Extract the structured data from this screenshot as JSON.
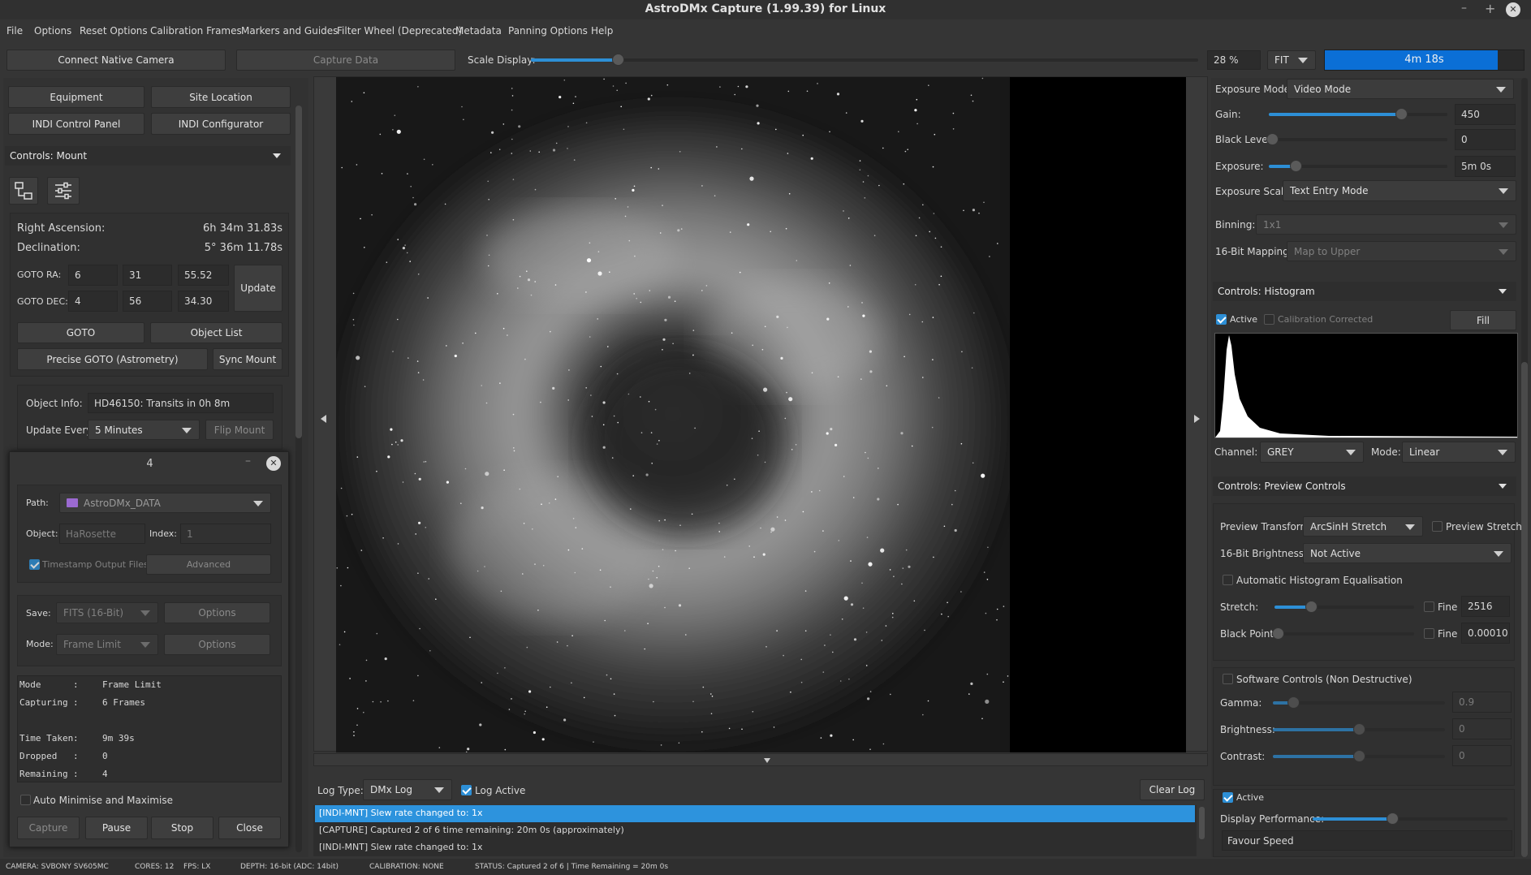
{
  "window": {
    "title": "AstroDMx Capture (1.99.39) for Linux",
    "min": "–",
    "max": "+",
    "close": "✕"
  },
  "menu": [
    "File",
    "Options",
    "Reset Options",
    "Calibration Frames",
    "Markers and Guides",
    "Filter Wheel (Deprecated)",
    "Metadata",
    "Panning Options",
    "Help"
  ],
  "toolbar": {
    "connect": "Connect Native Camera",
    "capture_data": "Capture Data",
    "scale_label": "Scale Display:",
    "scale_value": 0.13,
    "zoom": "28 %",
    "fit": "FIT",
    "timer": "4m 18s",
    "timer_progress": 0.87
  },
  "left": {
    "equipment": "Equipment",
    "site": "Site Location",
    "indi_panel": "INDI Control Panel",
    "indi_config": "INDI Configurator",
    "controls_mount": "Controls: Mount",
    "ra_label": "Right Ascension:",
    "ra_value": "6h 34m 31.83s",
    "dec_label": "Declination:",
    "dec_value": "5° 36m 11.78s",
    "goto_ra_label": "GOTO RA:",
    "goto_ra": [
      "6",
      "31",
      "55.52"
    ],
    "goto_dec_label": "GOTO DEC:",
    "goto_dec": [
      "4",
      "56",
      "34.30"
    ],
    "update": "Update",
    "goto": "GOTO",
    "object_list": "Object List",
    "precise_goto": "Precise GOTO (Astrometry)",
    "sync_mount": "Sync Mount",
    "object_info_label": "Object Info:",
    "object_info": "HD46150: Transits in 0h 8m",
    "update_every_label": "Update Every:",
    "update_every": "5 Minutes",
    "flip_mount": "Flip Mount"
  },
  "capture": {
    "title": "4",
    "path_label": "Path:",
    "path": "AstroDMx_DATA",
    "object_label": "Object:",
    "object": "HaRosette",
    "index_label": "Index:",
    "index": "1",
    "timestamp": "Timestamp Output Files",
    "advanced": "Advanced",
    "save_label": "Save:",
    "save": "FITS (16-Bit)",
    "options": "Options",
    "mode_label": "Mode:",
    "mode": "Frame Limit",
    "status": [
      {
        "k": "Mode",
        "v": "Frame Limit"
      },
      {
        "k": "Capturing",
        "v": "6 Frames"
      },
      {
        "k": "",
        "v": ""
      },
      {
        "k": "Time Taken",
        "v": "9m 39s"
      },
      {
        "k": "Dropped",
        "v": "0"
      },
      {
        "k": "Remaining",
        "v": "4"
      }
    ],
    "auto_min": "Auto Minimise and Maximise",
    "capture": "Capture",
    "pause": "Pause",
    "stop": "Stop",
    "close": "Close"
  },
  "log": {
    "type_label": "Log Type:",
    "type": "DMx Log",
    "active": "Log Active",
    "clear": "Clear Log",
    "lines": [
      "[INDI-MNT] Slew rate changed to: 1x",
      "[CAPTURE] Captured 2 of 6 time remaining: 20m 0s (approximately)",
      "[INDI-MNT] Slew rate changed to: 1x"
    ]
  },
  "right": {
    "exposure_mode_label": "Exposure Mode:",
    "exposure_mode": "Video Mode",
    "gain_label": "Gain:",
    "gain": "450",
    "gain_level": 0.74,
    "black_level_label": "Black Level:",
    "black_level": "0",
    "black_level_level": 0.0,
    "exposure_label": "Exposure:",
    "exposure": "5m 0s",
    "exposure_level": 0.15,
    "exposure_scale_label": "Exposure Scale:",
    "exposure_scale": "Text Entry Mode",
    "binning_label": "Binning:",
    "binning": "1x1",
    "mapping_label": "16-Bit Mapping:",
    "mapping": "Map to Upper",
    "histogram_title": "Controls: Histogram",
    "hist_active": "Active",
    "calib_corrected": "Calibration Corrected",
    "fill": "Fill",
    "channel_label": "Channel:",
    "channel": "GREY",
    "mode_label": "Mode:",
    "mode": "Linear",
    "preview_title": "Controls: Preview Controls",
    "preview_transform_label": "Preview Transform:",
    "preview_transform": "ArcSinH Stretch",
    "preview_stretch": "Preview Stretch",
    "brightness16_label": "16-Bit Brightness:",
    "brightness16": "Not Active",
    "auto_hist_eq": "Automatic Histogram Equalisation",
    "stretch_label": "Stretch:",
    "stretch": "2516",
    "stretch_level": 0.26,
    "fine": "Fine",
    "black_point_label": "Black Point:",
    "black_point": "0.00010",
    "black_point_level": 0.0,
    "software_controls": "Software Controls (Non Destructive)",
    "gamma_label": "Gamma:",
    "gamma": "0.9",
    "gamma_level": 0.12,
    "brightness_label": "Brightness:",
    "brightness": "0",
    "brightness_level": 0.5,
    "contrast_label": "Contrast:",
    "contrast": "0",
    "contrast_level": 0.5,
    "perf_active": "Active",
    "display_perf_label": "Display Performance:",
    "display_perf_level": 0.41,
    "favour": "Favour Speed"
  },
  "statusbar": {
    "camera": "CAMERA: SVBONY SV605MC",
    "cores": "CORES: 12",
    "fps": "FPS: LX",
    "depth": "DEPTH: 16-bit (ADC: 14bit)",
    "calibration": "CALIBRATION: NONE",
    "status": "STATUS: Captured 2 of 6 | Time Remaining = 20m 0s"
  }
}
